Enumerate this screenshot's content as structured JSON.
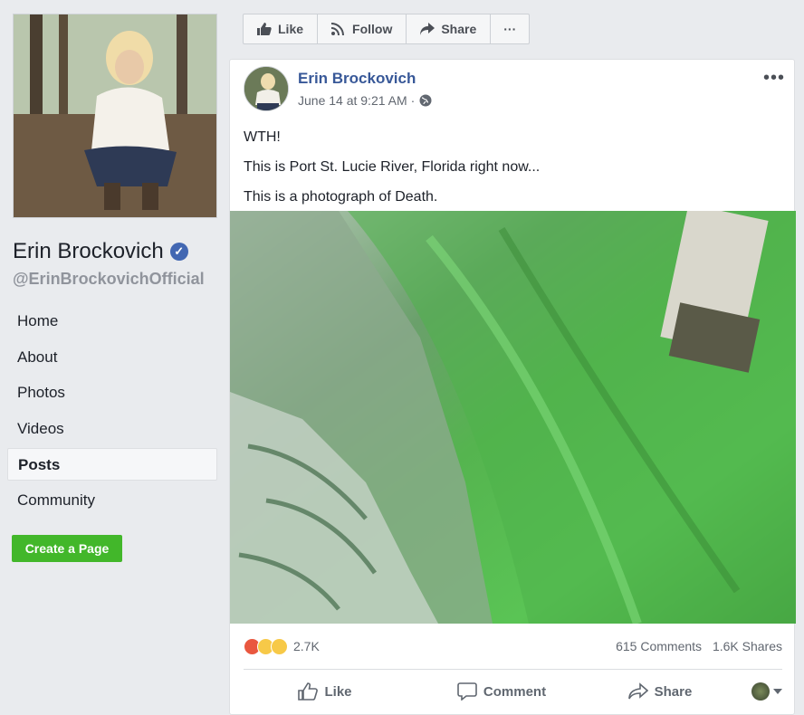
{
  "sidebar": {
    "page_name": "Erin Brockovich",
    "handle": "@ErinBrockovichOfficial",
    "nav": [
      {
        "label": "Home"
      },
      {
        "label": "About"
      },
      {
        "label": "Photos"
      },
      {
        "label": "Videos"
      },
      {
        "label": "Posts"
      },
      {
        "label": "Community"
      }
    ],
    "create_page_label": "Create a Page"
  },
  "topbar": {
    "like_label": "Like",
    "follow_label": "Follow",
    "share_label": "Share",
    "more_label": "···"
  },
  "post": {
    "author": "Erin Brockovich",
    "timestamp": "June 14 at 9:21 AM",
    "separator": "·",
    "more_label": "•••",
    "lines": [
      "WTH!",
      "This is Port St. Lucie River, Florida right now...",
      "This is a photograph of Death."
    ],
    "reaction_count": "2.7K",
    "comments": "615 Comments",
    "shares": "1.6K Shares",
    "actions": {
      "like": "Like",
      "comment": "Comment",
      "share": "Share"
    }
  },
  "colors": {
    "link_blue": "#385898",
    "brand_blue": "#4267b2",
    "create_green": "#42b72a",
    "background": "#e9ebee"
  },
  "icons": [
    "verified-badge-icon",
    "thumbs-up-icon",
    "rss-follow-icon",
    "share-arrow-icon",
    "globe-icon",
    "comment-bubble-icon",
    "caret-down-icon"
  ]
}
